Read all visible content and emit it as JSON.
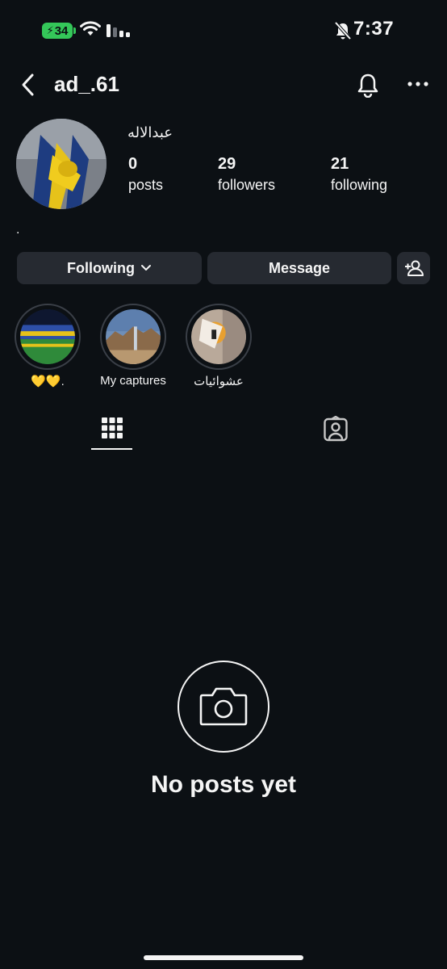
{
  "status_bar": {
    "battery": "34",
    "time": "7:37"
  },
  "header": {
    "username": "ad_.61"
  },
  "profile": {
    "display_name": "عبدالاله",
    "stats": [
      {
        "value": "0",
        "label": "posts"
      },
      {
        "value": "29",
        "label": "followers"
      },
      {
        "value": "21",
        "label": "following"
      }
    ],
    "bio": "."
  },
  "actions": {
    "following_label": "Following",
    "message_label": "Message"
  },
  "highlights": [
    {
      "label": "💛💛."
    },
    {
      "label": "My captures"
    },
    {
      "label": "عشوائيات"
    }
  ],
  "empty_state": {
    "text": "No posts yet"
  },
  "colors": {
    "background": "#0c1014",
    "button": "#262a31",
    "battery": "#34c759"
  }
}
